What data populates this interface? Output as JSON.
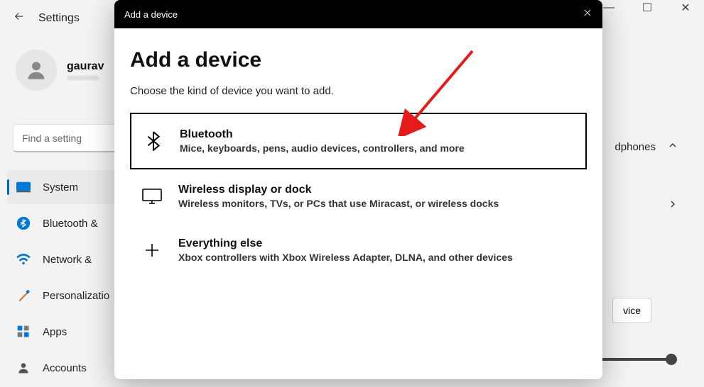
{
  "window": {
    "minimize": "—",
    "maximize": "☐",
    "close": "✕"
  },
  "header": {
    "title": "Settings"
  },
  "user": {
    "name": "gaurav"
  },
  "search": {
    "placeholder": "Find a setting"
  },
  "sidebar": {
    "items": [
      {
        "label": "System"
      },
      {
        "label": "Bluetooth &"
      },
      {
        "label": "Network &"
      },
      {
        "label": "Personalizatio"
      },
      {
        "label": "Apps"
      },
      {
        "label": "Accounts"
      }
    ]
  },
  "right": {
    "partial1": "dphones",
    "chevron": "›",
    "device_btn": "vice"
  },
  "modal": {
    "titlebar": "Add a device",
    "heading": "Add a device",
    "subtitle": "Choose the kind of device you want to add.",
    "options": [
      {
        "title": "Bluetooth",
        "desc": "Mice, keyboards, pens, audio devices, controllers, and more"
      },
      {
        "title": "Wireless display or dock",
        "desc": "Wireless monitors, TVs, or PCs that use Miracast, or wireless docks"
      },
      {
        "title": "Everything else",
        "desc": "Xbox controllers with Xbox Wireless Adapter, DLNA, and other devices"
      }
    ]
  }
}
